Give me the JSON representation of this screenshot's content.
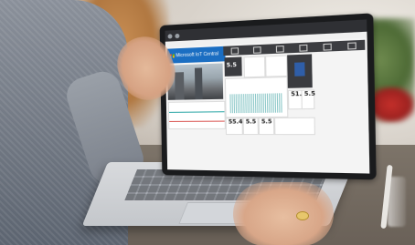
{
  "scene": {
    "description_colors": {
      "brand_blue": "#1b6ec2",
      "dark_tile": "#3a3b3f",
      "screen_bg": "#f4f4f4"
    }
  },
  "app": {
    "title": "Microsoft IoT Central",
    "tiles": [
      {
        "value": "5.5"
      },
      {
        "value": "51.1"
      },
      {
        "value": "5.5"
      },
      {
        "value": "55.4"
      },
      {
        "value": "5.5"
      },
      {
        "value": "5.5"
      }
    ]
  }
}
